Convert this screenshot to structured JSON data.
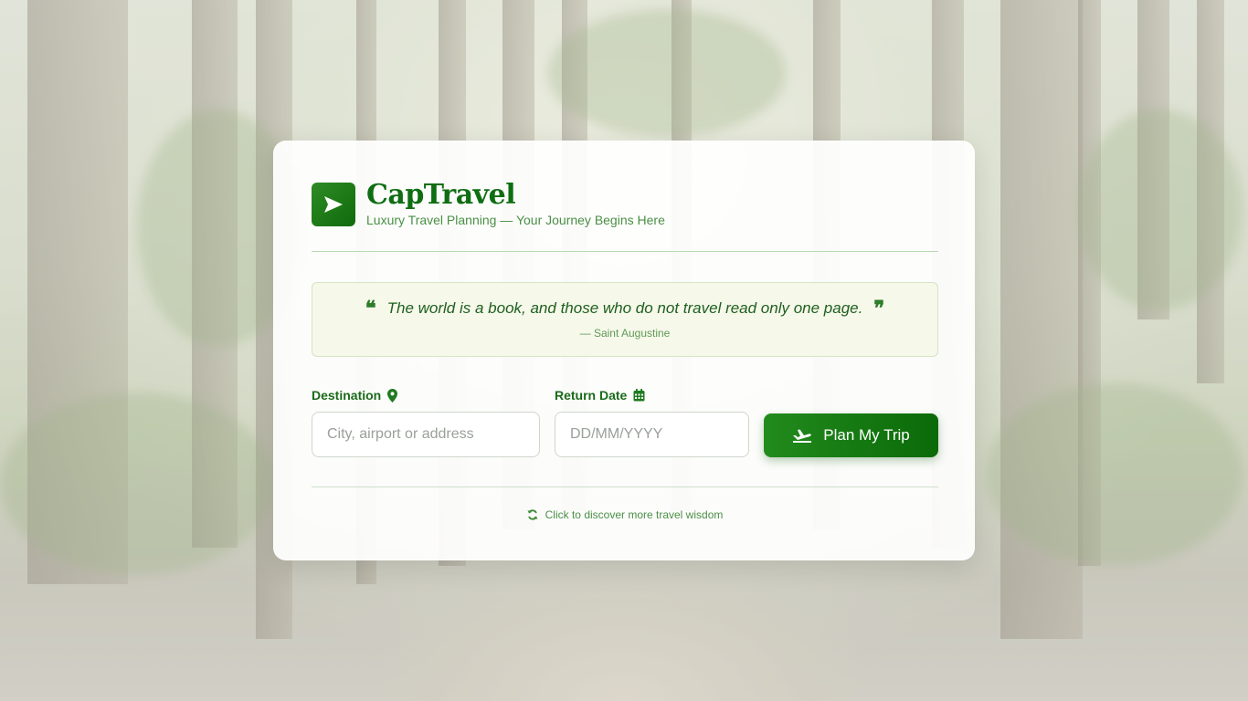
{
  "brand": {
    "name": "CapTravel",
    "tagline": "Luxury Travel Planning — Your Journey Begins Here"
  },
  "quote": {
    "text": "The world is a book, and those who do not travel read only one page.",
    "author": "— Saint Augustine"
  },
  "form": {
    "destination_label": "Destination",
    "destination_placeholder": "City, airport or address",
    "return_label": "Return Date",
    "return_placeholder": "DD/MM/YYYY",
    "submit_label": "Plan My Trip"
  },
  "footer": {
    "discover_label": "Click to discover more travel wisdom"
  },
  "colors": {
    "primary": "#0f6d12",
    "accent": "#228b1d"
  },
  "icons": {
    "logo": "paper-plane-icon",
    "destination": "map-pin-icon",
    "return_date": "calendar-icon",
    "submit": "plane-departure-icon",
    "discover": "refresh-icon"
  }
}
